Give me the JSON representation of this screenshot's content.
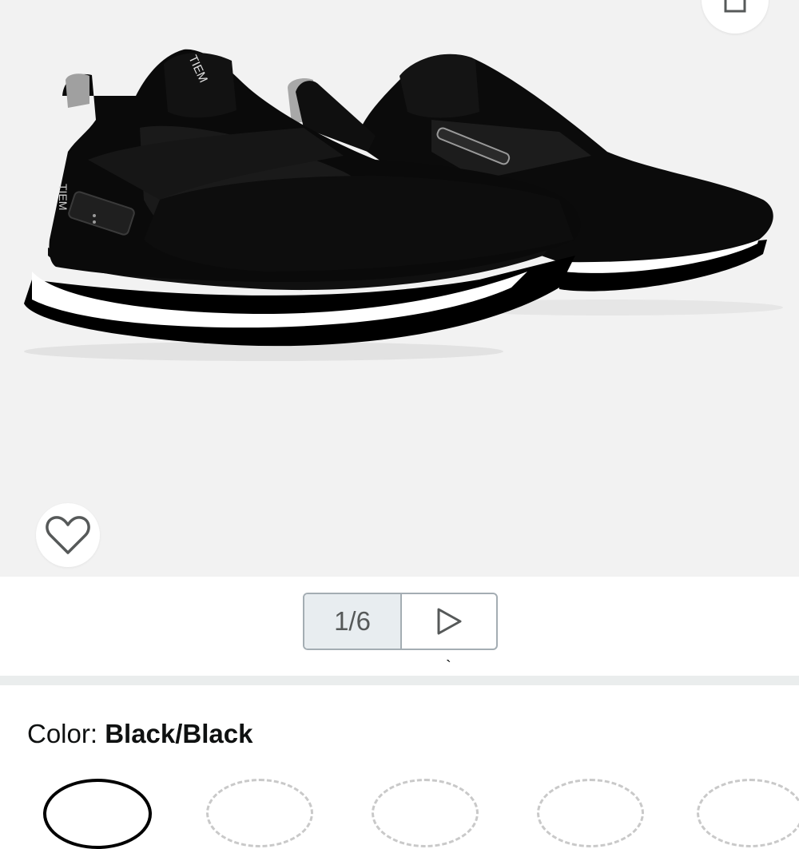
{
  "gallery": {
    "image_alt": "Black slip-on cycling shoes with white sole",
    "brand_print": "TIEM",
    "page_indicator": "1/6",
    "colors": {
      "background": "#f2f2f2",
      "pager_border": "#a4adb3"
    }
  },
  "icons": {
    "share": "share-icon",
    "wishlist": "heart-icon",
    "next": "play-triangle-icon"
  },
  "variation": {
    "color_label": "Color:",
    "color_value": "Black/Black"
  },
  "tick": "`"
}
